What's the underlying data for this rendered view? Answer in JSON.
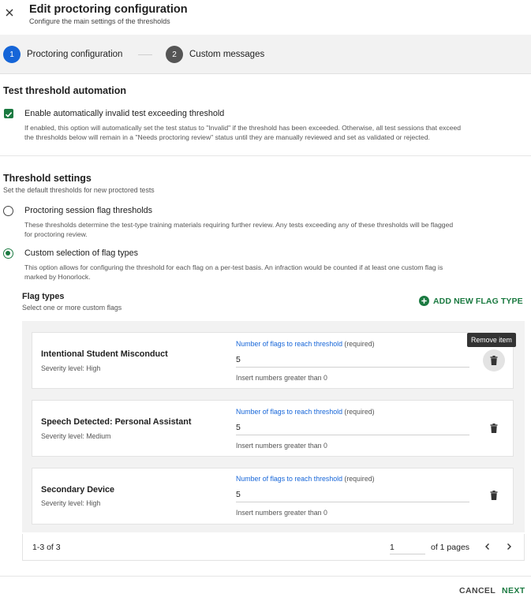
{
  "header": {
    "title": "Edit proctoring configuration",
    "subtitle": "Configure the main settings of the thresholds",
    "close_icon": "close-icon"
  },
  "stepper": {
    "steps": [
      {
        "number": "1",
        "label": "Proctoring configuration",
        "active": true
      },
      {
        "number": "2",
        "label": "Custom messages",
        "active": false
      }
    ]
  },
  "automation": {
    "title": "Test threshold automation",
    "checkbox_label": "Enable automatically invalid test exceeding threshold",
    "checked": true,
    "description_line1": "If enabled, this option will automatically set the test status to \"Invalid\" if the threshold has been exceeded. Otherwise, all test sessions that exceed",
    "description_line2": "the thresholds below will remain in a \"Needs proctoring review\" status until they are manually reviewed and set as validated or rejected."
  },
  "threshold": {
    "title": "Threshold settings",
    "subtitle": "Set the default thresholds for new proctored tests",
    "options": [
      {
        "label": "Proctoring session flag thresholds",
        "selected": false,
        "description_line1": "These thresholds determine the test-type training materials requiring further review. Any tests exceeding any of these thresholds will be flagged",
        "description_line2": "for proctoring review."
      },
      {
        "label": "Custom selection of flag types",
        "selected": true,
        "description_line1": "This option allows for configuring the threshold for each flag on a per-test basis. An infraction would be counted if at least one custom flag is",
        "description_line2": "marked by Honorlock."
      }
    ]
  },
  "flags": {
    "title": "Flag types",
    "subtitle": "Select one or more custom flags",
    "add_label": "ADD NEW FLAG TYPE",
    "field_label_link": "Number of flags to reach threshold",
    "field_label_suffix": " (required)",
    "field_help": "Insert numbers greater than 0",
    "tooltip": "Remove item",
    "items": [
      {
        "name": "Intentional Student Misconduct",
        "severity": "Severity level: High",
        "value": "5"
      },
      {
        "name": "Speech Detected: Personal Assistant",
        "severity": "Severity level: Medium",
        "value": "5"
      },
      {
        "name": "Secondary Device",
        "severity": "Severity level: High",
        "value": "5"
      }
    ]
  },
  "pagination": {
    "range": "1-3 of 3",
    "page": "1",
    "of_pages": "of 1 pages"
  },
  "footer": {
    "cancel": "CANCEL",
    "next": "NEXT"
  },
  "colors": {
    "primary_blue": "#1565d8",
    "accent_green": "#1b7a41"
  }
}
